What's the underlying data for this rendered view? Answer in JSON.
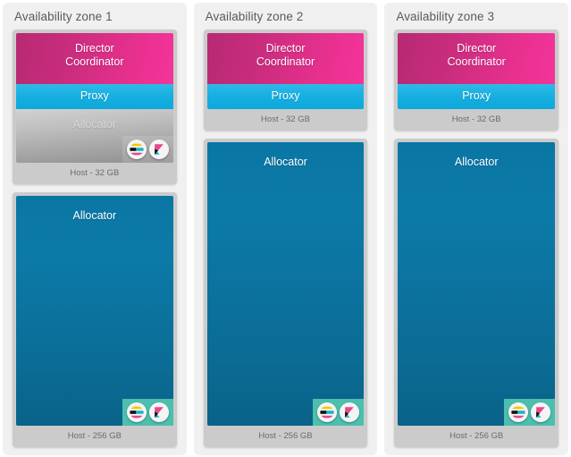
{
  "layout": {
    "zone_count": 3,
    "background": "#ffffff",
    "panel_background": "#f0f0f0"
  },
  "colors": {
    "director_pink": "#d42c85",
    "proxy_blue": "#17ade0",
    "allocator_blue": "#0b719c",
    "allocator_gray": "#aaaaaa",
    "host_card_gray": "#cbcbcb",
    "icon_tray_teal": "#4cbfae",
    "title_text": "#5a5a5a",
    "host_label_text": "#6b6b6b"
  },
  "labels": {
    "director_coordinator_line1": "Director",
    "director_coordinator_line2": "Coordinator",
    "proxy": "Proxy",
    "allocator": "Allocator"
  },
  "icons": {
    "elasticsearch": "elasticsearch-icon",
    "kibana": "kibana-icon"
  },
  "zones": [
    {
      "title": "Availability zone 1",
      "top_host": {
        "host_label": "Host - 32 GB",
        "blocks": [
          "director-coordinator",
          "proxy",
          "allocator-gray"
        ],
        "has_icons": true
      },
      "bottom_host": {
        "host_label": "Host - 256 GB",
        "blocks": [
          "allocator-blue"
        ],
        "has_icons": true
      }
    },
    {
      "title": "Availability zone 2",
      "top_host": {
        "host_label": "Host - 32 GB",
        "blocks": [
          "director-coordinator",
          "proxy"
        ],
        "has_icons": false
      },
      "bottom_host": {
        "host_label": "Host - 256 GB",
        "blocks": [
          "allocator-blue"
        ],
        "has_icons": true
      }
    },
    {
      "title": "Availability zone 3",
      "top_host": {
        "host_label": "Host - 32 GB",
        "blocks": [
          "director-coordinator",
          "proxy"
        ],
        "has_icons": false
      },
      "bottom_host": {
        "host_label": "Host - 256 GB",
        "blocks": [
          "allocator-blue"
        ],
        "has_icons": true
      }
    }
  ]
}
